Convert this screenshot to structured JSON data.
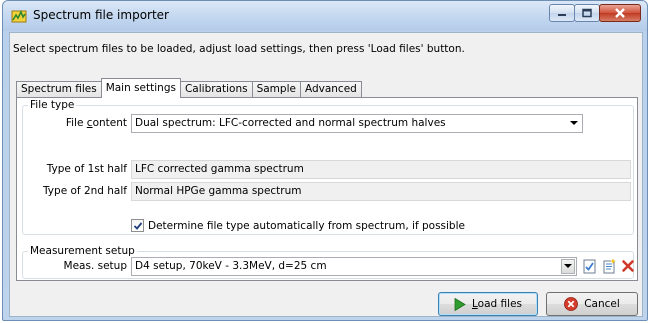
{
  "window": {
    "title": "Spectrum file importer"
  },
  "instructions": "Select spectrum files to be loaded, adjust load settings, then press 'Load files' button.",
  "tabs": [
    {
      "label": "Spectrum files",
      "active": false
    },
    {
      "label": "Main settings",
      "active": true
    },
    {
      "label": "Calibrations",
      "active": false
    },
    {
      "label": "Sample",
      "active": false
    },
    {
      "label": "Advanced",
      "active": false
    }
  ],
  "file_type": {
    "legend": "File type",
    "content_label_pre": "File ",
    "content_label_mnemonic": "c",
    "content_label_post": "ontent",
    "content_value": "Dual spectrum: LFC-corrected and normal spectrum halves",
    "first_half_label": "Type of 1st half",
    "first_half_value": "LFC corrected gamma spectrum",
    "second_half_label": "Type of 2nd half",
    "second_half_value": "Normal HPGe gamma spectrum",
    "auto_detect_label": "Determine file type automatically from spectrum, if possible",
    "auto_detect_checked": true
  },
  "measurement": {
    "legend": "Measurement setup",
    "setup_label": "Meas. setup",
    "setup_value": "D4 setup, 70keV - 3.3MeV, d=25 cm"
  },
  "buttons": {
    "load_mnemonic": "L",
    "load_rest": "oad files",
    "cancel": "Cancel"
  },
  "icons": {
    "app": "spectrum-app-icon",
    "edit": "edit-setup-icon",
    "new": "new-setup-icon",
    "delete": "delete-setup-icon",
    "load": "play-arrow-icon",
    "cancel": "cancel-x-icon"
  },
  "colors": {
    "accent_green": "#2e9d2e",
    "delete_red": "#d03a2a",
    "cancel_red": "#d33b2c"
  }
}
